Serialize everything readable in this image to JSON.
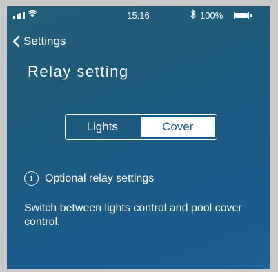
{
  "statusbar": {
    "time": "15:16",
    "battery_pct": "100%",
    "icons": [
      "signal-icon",
      "wifi-icon",
      "bluetooth-icon",
      "battery-icon"
    ]
  },
  "nav": {
    "back_label": "Settings"
  },
  "page": {
    "title": "Relay setting"
  },
  "relay_toggle": {
    "options": [
      "Lights",
      "Cover"
    ],
    "selected": "Cover"
  },
  "info": {
    "label": "Optional  relay settings",
    "description": "Switch between lights control and pool cover control."
  },
  "colors": {
    "background_top": "#25607a",
    "background_bottom": "#1e6192",
    "accent": "#ffffff"
  }
}
